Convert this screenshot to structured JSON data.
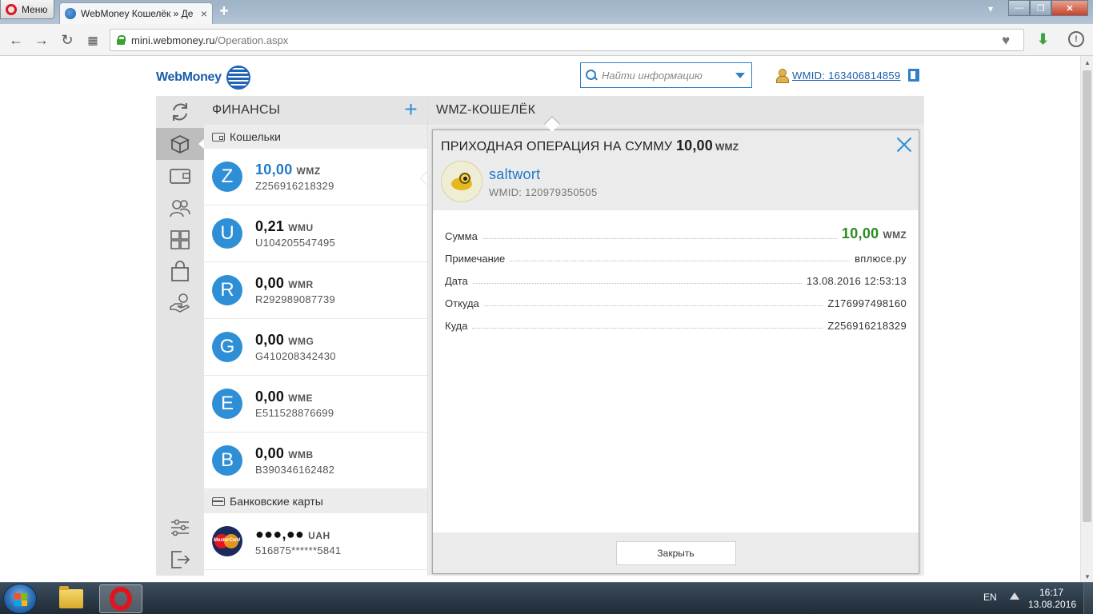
{
  "browser": {
    "menu_label": "Меню",
    "tab_title": "WebMoney Кошелёк » Де",
    "tab_close": "×",
    "new_tab": "+",
    "url_host": "mini.webmoney.ru",
    "url_path": "/Operation.aspx",
    "window_controls": {
      "min": "—",
      "max": "❐",
      "close": "✕"
    }
  },
  "header": {
    "logo_text": "WebMoney",
    "search_placeholder": "Найти информацию",
    "wmid_label": "WMID: 163406814859"
  },
  "finance_panel": {
    "title": "ФИНАНСЫ",
    "add": "+",
    "wallets_section": "Кошельки",
    "wallets": [
      {
        "letter": "Z",
        "amount": "10,00",
        "currency": "WMZ",
        "number": "Z256916218329",
        "selected": true
      },
      {
        "letter": "U",
        "amount": "0,21",
        "currency": "WMU",
        "number": "U104205547495"
      },
      {
        "letter": "R",
        "amount": "0,00",
        "currency": "WMR",
        "number": "R292989087739"
      },
      {
        "letter": "G",
        "amount": "0,00",
        "currency": "WMG",
        "number": "G410208342430"
      },
      {
        "letter": "E",
        "amount": "0,00",
        "currency": "WME",
        "number": "E511528876699"
      },
      {
        "letter": "B",
        "amount": "0,00",
        "currency": "WMB",
        "number": "B390346162482"
      }
    ],
    "cards_section": "Банковские карты",
    "card": {
      "brand": "MasterCard",
      "amount": "●●●,●●",
      "currency": "UAH",
      "number": "516875******5841"
    }
  },
  "wallet_view": {
    "title": "WMZ-КОШЕЛЁК"
  },
  "operation": {
    "title_prefix": "ПРИХОДНАЯ ОПЕРАЦИЯ НА СУММУ",
    "title_amount": "10,00",
    "title_currency": "WMZ",
    "sender_name": "saltwort",
    "sender_wmid": "WMID: 120979350505",
    "rows": {
      "sum_label": "Сумма",
      "sum_value": "10,00",
      "sum_currency": "WMZ",
      "note_label": "Примечание",
      "note_value": "вплюсе.ру",
      "date_label": "Дата",
      "date_value": "13.08.2016 12:53:13",
      "from_label": "Откуда",
      "from_value": "Z176997498160",
      "to_label": "Куда",
      "to_value": "Z256916218329"
    },
    "close_button": "Закрыть"
  },
  "taskbar": {
    "lang": "EN",
    "time": "16:17",
    "date": "13.08.2016"
  },
  "colors": {
    "accent_blue": "#2f8fd6",
    "amount_green": "#2c8a1f",
    "link_blue": "#1a5ca8"
  }
}
